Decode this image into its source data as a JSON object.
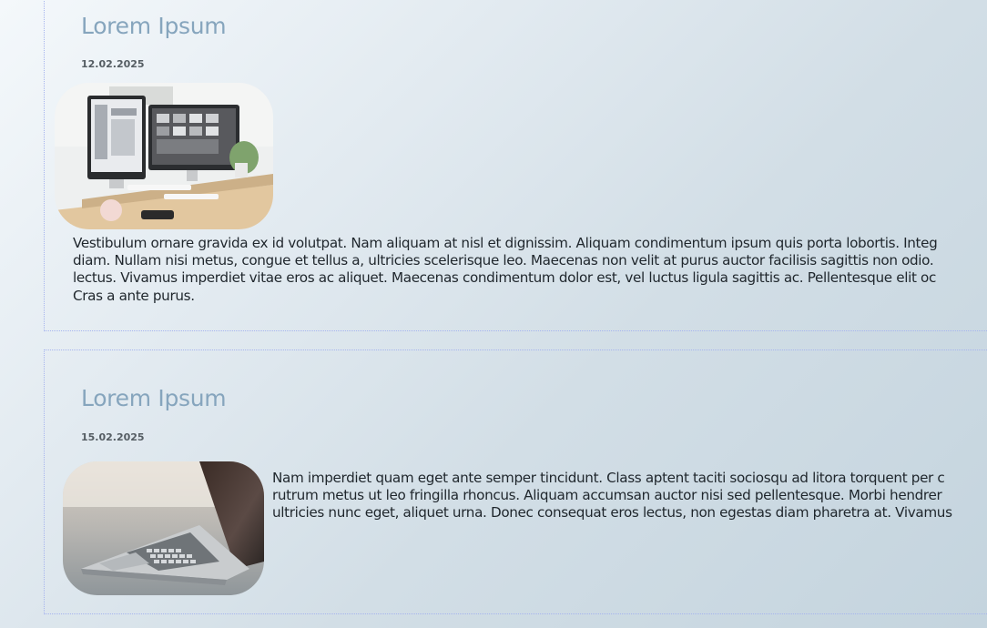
{
  "posts": [
    {
      "title": "Lorem Ipsum",
      "date": "12.02.2025",
      "image_icon": "desktop-computers-image",
      "body_lines": [
        "Vestibulum ornare gravida ex id volutpat. Nam aliquam at nisl et dignissim. Aliquam condimentum ipsum quis porta lobortis. Integ",
        "diam. Nullam nisi metus, congue et tellus a, ultricies scelerisque leo. Maecenas non velit at purus auctor facilisis sagittis non odio.",
        "lectus. Vivamus imperdiet vitae eros ac aliquet. Maecenas condimentum dolor est, vel luctus ligula sagittis ac. Pellentesque elit oc",
        "Cras a ante purus."
      ]
    },
    {
      "title": "Lorem Ipsum",
      "date": "15.02.2025",
      "image_icon": "laptop-image",
      "body_lines": [
        "Nam imperdiet quam eget ante semper tincidunt. Class aptent taciti sociosqu ad litora torquent per c",
        "rutrum metus ut leo fringilla rhoncus. Aliquam accumsan auctor nisi sed pellentesque. Morbi hendrer",
        "ultricies nunc eget, aliquet urna. Donec consequat eros lectus, non egestas diam pharetra at. Vivamus"
      ]
    }
  ],
  "colors": {
    "title": "#86a5bd",
    "date": "#555d63",
    "body": "#1f262c",
    "border": "#a6b4ee"
  }
}
